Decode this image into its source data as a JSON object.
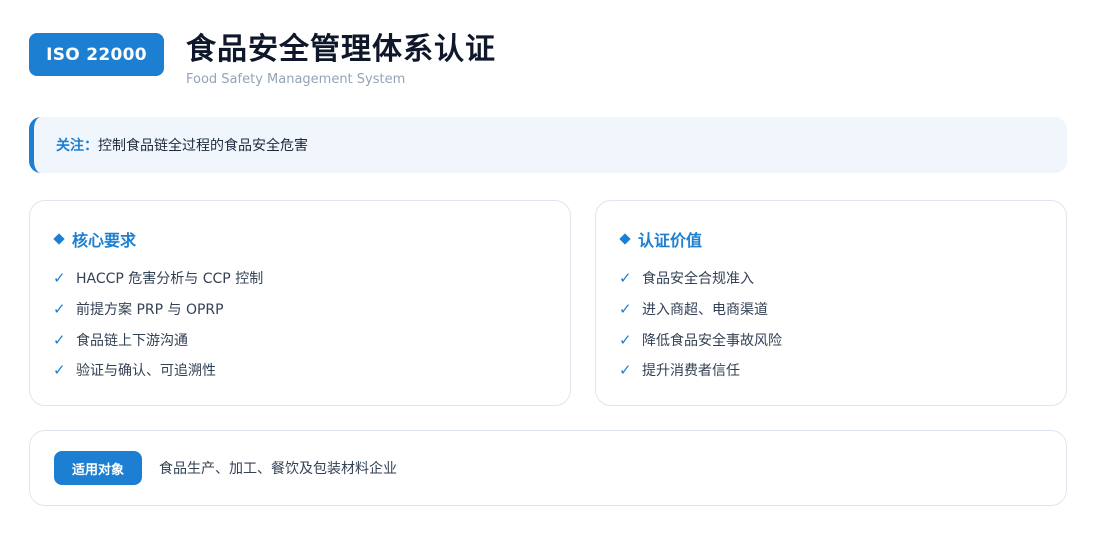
{
  "header": {
    "badge": "ISO 22000",
    "title": "食品安全管理体系认证",
    "subtitle": "Food Safety Management System"
  },
  "focus": {
    "label": "关注：",
    "text": "控制食品链全过程的食品安全危害"
  },
  "requirements": {
    "heading": "核心要求",
    "items": [
      "HACCP 危害分析与 CCP 控制",
      "前提方案 PRP 与 OPRP",
      "食品链上下游沟通",
      "验证与确认、可追溯性"
    ]
  },
  "value": {
    "heading": "认证价值",
    "items": [
      "食品安全合规准入",
      "进入商超、电商渠道",
      "降低食品安全事故风险",
      "提升消费者信任"
    ]
  },
  "scope": {
    "tag": "适用对象",
    "text": "食品生产、加工、餐饮及包装材料企业"
  },
  "icons": {
    "check": "✓",
    "diamond": "diamond-icon"
  },
  "colors": {
    "accent": "#1d7fd1",
    "title": "#0f172a",
    "focus_bg": "#f1f6fd"
  }
}
